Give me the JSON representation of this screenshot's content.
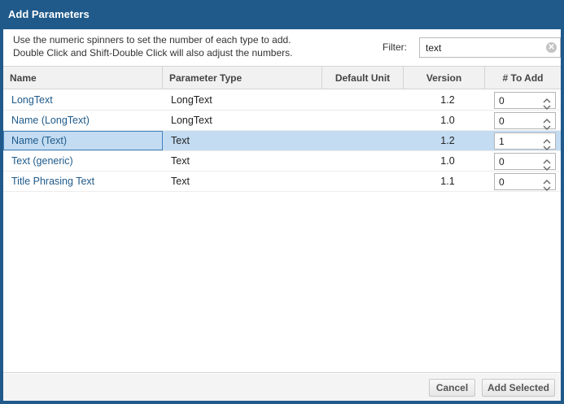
{
  "dialog": {
    "title": "Add Parameters",
    "intro_line1": "Use the numeric spinners to set the number of each type to add.",
    "intro_line2": "Double Click and Shift-Double Click will also adjust the numbers.",
    "filter_label": "Filter:",
    "filter_value": "text",
    "clear_icon": "✕"
  },
  "table": {
    "columns": {
      "name": "Name",
      "type": "Parameter Type",
      "unit": "Default Unit",
      "version": "Version",
      "to_add": "# To Add"
    },
    "rows": [
      {
        "name": "LongText",
        "type": "LongText",
        "unit": "",
        "version": "1.2",
        "to_add": "0",
        "selected": false
      },
      {
        "name": "Name (LongText)",
        "type": "LongText",
        "unit": "",
        "version": "1.0",
        "to_add": "0",
        "selected": false
      },
      {
        "name": "Name (Text)",
        "type": "Text",
        "unit": "",
        "version": "1.2",
        "to_add": "1",
        "selected": true
      },
      {
        "name": "Text (generic)",
        "type": "Text",
        "unit": "",
        "version": "1.0",
        "to_add": "0",
        "selected": false
      },
      {
        "name": "Title Phrasing Text",
        "type": "Text",
        "unit": "",
        "version": "1.1",
        "to_add": "0",
        "selected": false
      }
    ]
  },
  "footer": {
    "cancel_label": "Cancel",
    "add_selected_label": "Add Selected"
  },
  "colors": {
    "title_bar": "#1f5a8a",
    "link_text": "#1f5a8a",
    "selected_row": "#c3dcf2"
  }
}
